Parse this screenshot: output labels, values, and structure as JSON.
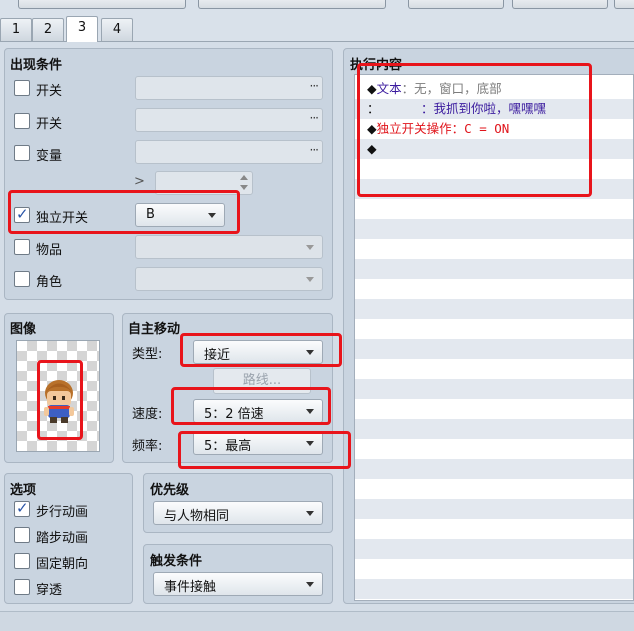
{
  "tabs": [
    "1",
    "2",
    "3",
    "4"
  ],
  "appear": {
    "title": "出现条件",
    "switch1": "开关",
    "switch2": "开关",
    "variable": "变量",
    "var_compare": ">",
    "self_switch": "独立开关",
    "self_switch_value": "B",
    "item": "物品",
    "actor": "角色",
    "dots": "···"
  },
  "image": {
    "title": "图像"
  },
  "autonomous": {
    "title": "自主移动",
    "type_label": "类型:",
    "type_value": "接近",
    "route_button": "路线...",
    "speed_label": "速度:",
    "speed_value": "5：2 倍速",
    "freq_label": "频率:",
    "freq_value": "5：最高"
  },
  "options": {
    "title": "选项",
    "walking": "步行动画",
    "stepping": "踏步动画",
    "direction_fix": "固定朝向",
    "through": "穿透"
  },
  "priority": {
    "title": "优先级",
    "value": "与人物相同"
  },
  "trigger": {
    "title": "触发条件",
    "value": "事件接触"
  },
  "contents": {
    "title": "执行内容",
    "rows": [
      {
        "marker": "◆",
        "a": "文本",
        "b": "：无，窗口，底部"
      },
      {
        "marker": "：",
        "a": "",
        "b": "：我抓到你啦，嘿嘿嘿"
      },
      {
        "marker": "◆",
        "a": "独立开关操作",
        "b": "：C = ON"
      },
      {
        "marker": "◆",
        "a": "",
        "b": ""
      }
    ]
  },
  "colors": {
    "text_purple": "#3a1a9e",
    "text_gray": "#7c7c7c",
    "text_red": "#e0141b",
    "annotation": "#e8141b"
  }
}
